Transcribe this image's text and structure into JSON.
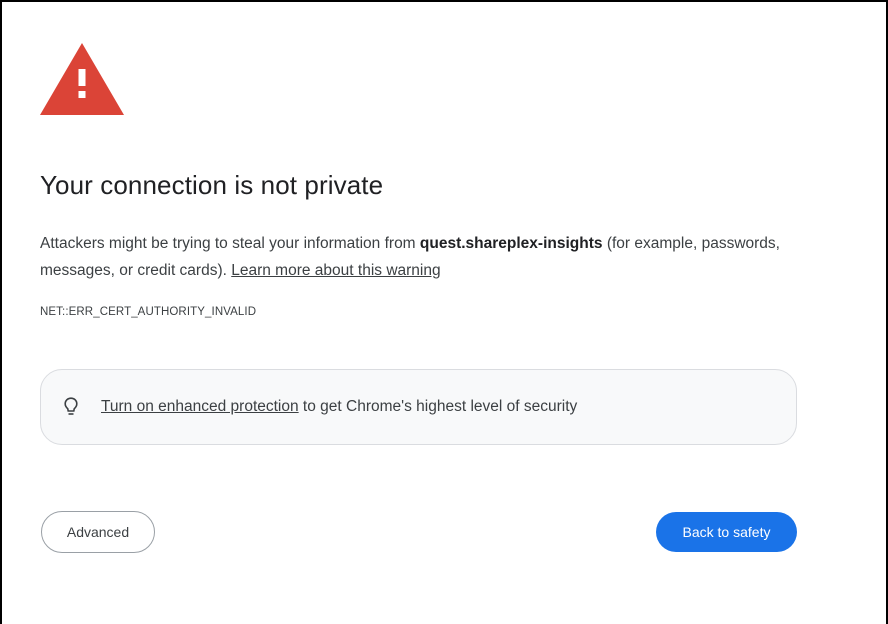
{
  "colors": {
    "warning_red": "#db4437",
    "primary_blue": "#1a73e8",
    "text": "#202124",
    "muted_text": "#3c4043",
    "promo_bg": "#f8f9fa"
  },
  "icons": {
    "warning": "warning-triangle-icon",
    "bulb": "lightbulb-icon"
  },
  "interstitial": {
    "title": "Your connection is not private",
    "message_prefix": "Attackers might be trying to steal your information from ",
    "hostname": "quest.shareplex-insights",
    "message_suffix": " (for example, passwords, messages, or credit cards). ",
    "learn_more_link": "Learn more about this warning",
    "error_code": "NET::ERR_CERT_AUTHORITY_INVALID"
  },
  "promo": {
    "link_text": "Turn on enhanced protection",
    "text": " to get Chrome's highest level of security"
  },
  "buttons": {
    "advanced": "Advanced",
    "back_to_safety": "Back to safety"
  }
}
